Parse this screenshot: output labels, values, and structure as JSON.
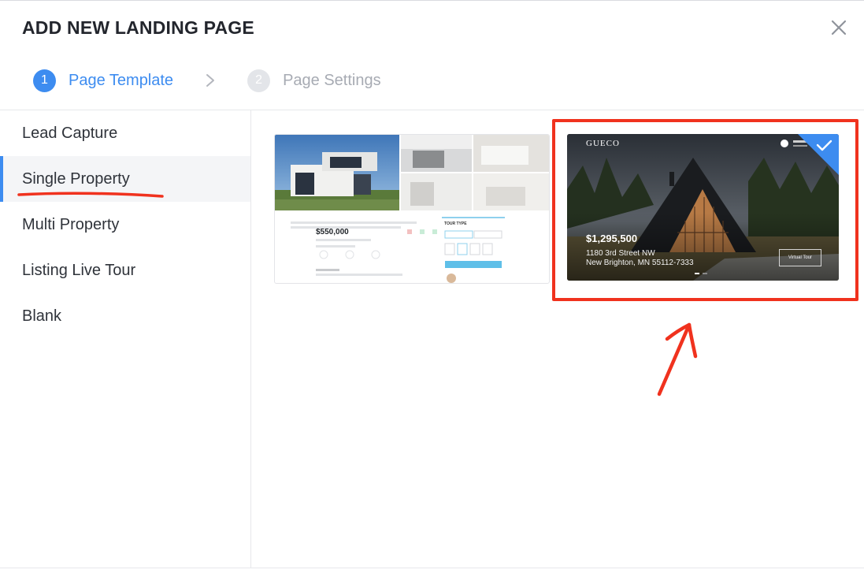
{
  "dialog": {
    "title": "ADD NEW LANDING PAGE",
    "close_icon": "close-icon"
  },
  "steps": [
    {
      "number": "1",
      "label": "Page Template",
      "state": "active"
    },
    {
      "number": "2",
      "label": "Page Settings",
      "state": "inactive"
    }
  ],
  "sidebar": {
    "items": [
      {
        "label": "Lead Capture",
        "selected": false
      },
      {
        "label": "Single Property",
        "selected": true
      },
      {
        "label": "Multi Property",
        "selected": false
      },
      {
        "label": "Listing Live Tour",
        "selected": false
      },
      {
        "label": "Blank",
        "selected": false
      }
    ]
  },
  "templates": [
    {
      "id": "template-1",
      "selected": false,
      "price": "$550,000",
      "tour_type_label": "TOUR TYPE"
    },
    {
      "id": "template-2",
      "selected": true,
      "logo": "GUECO",
      "price": "$1,295,500",
      "address_line1": "1180 3rd Street NW",
      "address_line2": "New Brighton, MN 55112-7333",
      "virtual_tour_label": "Virtual Tour"
    }
  ],
  "colors": {
    "accent": "#3d8cf0",
    "annotation": "#f0321e",
    "step_inactive": "#e3e5e9"
  }
}
